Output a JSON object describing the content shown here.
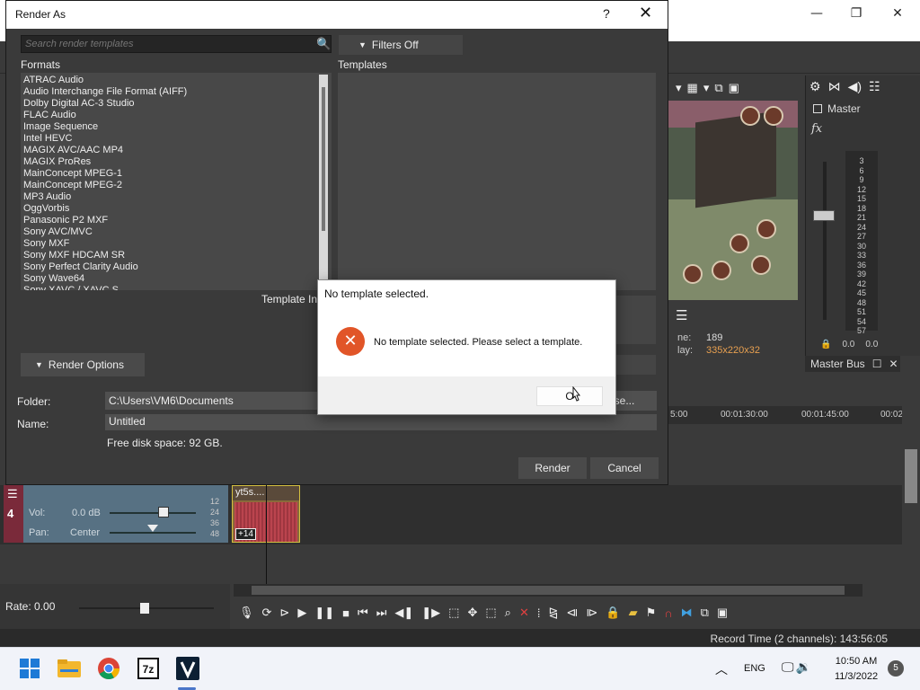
{
  "render_dialog": {
    "title": "Render As",
    "help_label": "?",
    "close_label": "✕",
    "search_placeholder": "Search render templates",
    "filters_label": "Filters Off",
    "formats_label": "Formats",
    "templates_label": "Templates",
    "formats": [
      "ATRAC Audio",
      "Audio Interchange File Format (AIFF)",
      "Dolby Digital AC-3 Studio",
      "FLAC Audio",
      "Image Sequence",
      "Intel HEVC",
      "MAGIX AVC/AAC MP4",
      "MAGIX ProRes",
      "MainConcept MPEG-1",
      "MainConcept MPEG-2",
      "MP3 Audio",
      "OggVorbis",
      "Panasonic P2 MXF",
      "Sony AVC/MVC",
      "Sony MXF",
      "Sony MXF HDCAM SR",
      "Sony Perfect Clarity Audio",
      "Sony Wave64",
      "Sony XAVC / XAVC S"
    ],
    "template_info_label": "Template Inf",
    "render_options_label": "Render Options",
    "folder_label": "Folder:",
    "folder_value": "C:\\Users\\VM6\\Documents",
    "browse_label": "wse...",
    "name_label": "Name:",
    "name_value": "Untitled",
    "disk_space": "Free disk space: 92 GB.",
    "render_button": "Render",
    "cancel_button": "Cancel"
  },
  "message_box": {
    "title": "No template selected.",
    "message": "No template selected.  Please select a template.",
    "ok_button": "O",
    "icon": "error-icon",
    "icon_color": "#e15528"
  },
  "vegas": {
    "preview_info": {
      "row1_label": "ne:",
      "row1_value": "189",
      "row2_label": "lay:",
      "row2_value": "335x220x32"
    },
    "mixer": {
      "master_label": "Master",
      "fx_label": "fx",
      "meter_ticks": [
        "3",
        "6",
        "9",
        "12",
        "15",
        "18",
        "21",
        "24",
        "27",
        "30",
        "33",
        "36",
        "39",
        "42",
        "45",
        "48",
        "51",
        "54",
        "57"
      ],
      "left_level": "0.0",
      "right_level": "0.0"
    },
    "master_bus_label": "Master Bus",
    "ruler": [
      "5:00",
      "00:01:30:00",
      "00:01:45:00",
      "00:02"
    ],
    "track": {
      "number": "4",
      "vol_label": "Vol:",
      "vol_value": "0.0 dB",
      "pan_label": "Pan:",
      "pan_value": "Center",
      "scale": [
        "12",
        "24",
        "36",
        "48"
      ],
      "clip_name": "yt5s....",
      "clip_gain": "+14"
    },
    "rate_label": "Rate: 0.00",
    "status_text": "Record Time (2 channels): 143:56:05"
  },
  "taskbar": {
    "lang": "ENG",
    "time": "10:50 AM",
    "date": "11/3/2022",
    "notification_count": "5"
  }
}
